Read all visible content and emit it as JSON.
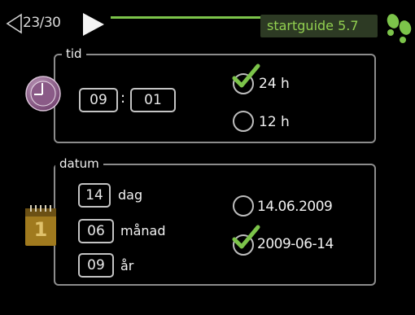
{
  "header": {
    "page_counter": "23/30",
    "title": "startguide 5.7",
    "accent_color": "#7cc44a"
  },
  "time_section": {
    "legend": "tid",
    "icon": "clock-icon",
    "hours": "09",
    "separator": ":",
    "minutes": "01",
    "options": [
      {
        "label": "24 h",
        "selected": true
      },
      {
        "label": "12 h",
        "selected": false
      }
    ]
  },
  "date_section": {
    "legend": "datum",
    "icon": "calendar-icon",
    "calendar_day": "1",
    "fields": [
      {
        "value": "14",
        "label": "dag"
      },
      {
        "value": "06",
        "label": "månad"
      },
      {
        "value": "09",
        "label": "år"
      }
    ],
    "options": [
      {
        "label": "14.06.2009",
        "selected": false
      },
      {
        "label": "2009-06-14",
        "selected": true
      }
    ]
  },
  "icons": {
    "back": "arrow-left-icon",
    "forward": "arrow-right-icon",
    "help": "footsteps-icon"
  }
}
